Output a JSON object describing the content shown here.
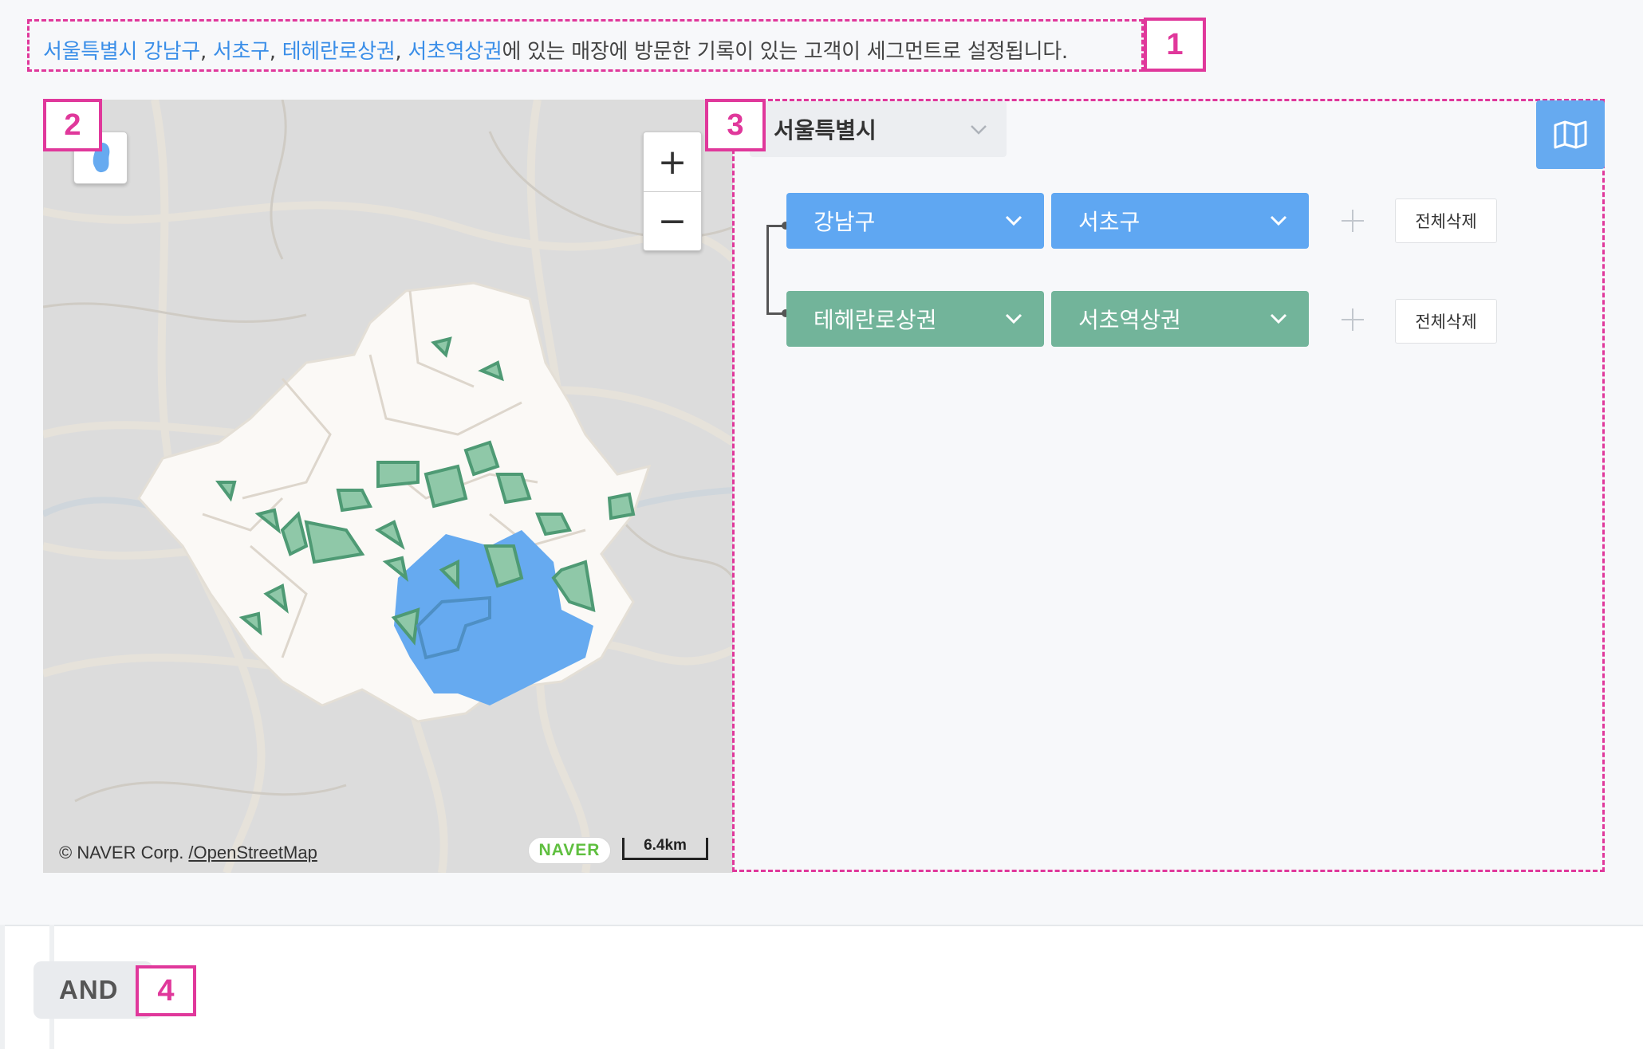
{
  "summary": {
    "parts": [
      {
        "text": "서울특별시 강남구",
        "highlight": true
      },
      {
        "text": ", ",
        "highlight": false
      },
      {
        "text": "서초구",
        "highlight": true
      },
      {
        "text": ", ",
        "highlight": false
      },
      {
        "text": "테헤란로상권",
        "highlight": true
      },
      {
        "text": ", ",
        "highlight": false
      },
      {
        "text": "서초역상권",
        "highlight": true
      },
      {
        "text": "에 있는 매장에 방문한 기록이 있는 고객이 세그먼트로 설정됩니다.",
        "highlight": false
      }
    ],
    "highlight_color": "#3a8ee8"
  },
  "callouts": [
    "1",
    "2",
    "3",
    "4"
  ],
  "map": {
    "zoom_in": "+",
    "zoom_out": "−",
    "copyright": "© NAVER Corp.",
    "osm_link": "/OpenStreetMap",
    "naver_logo": "NAVER",
    "scale": "6.4km",
    "colors": {
      "selected_district": "#66aaf0",
      "commercial_area": "#72b49a",
      "seoul_fill": "#fbf9f6"
    }
  },
  "panel": {
    "city": "서울특별시",
    "map_toggle_icon": "map-icon",
    "rows": [
      {
        "tags": [
          {
            "label": "강남구",
            "color": "#5fa7f2"
          },
          {
            "label": "서초구",
            "color": "#5fa7f2"
          }
        ],
        "delete_label": "전체삭제"
      },
      {
        "tags": [
          {
            "label": "테헤란로상권",
            "color": "#72b49a"
          },
          {
            "label": "서초역상권",
            "color": "#72b49a"
          }
        ],
        "delete_label": "전체삭제"
      }
    ]
  },
  "bottom": {
    "operator": "AND"
  }
}
